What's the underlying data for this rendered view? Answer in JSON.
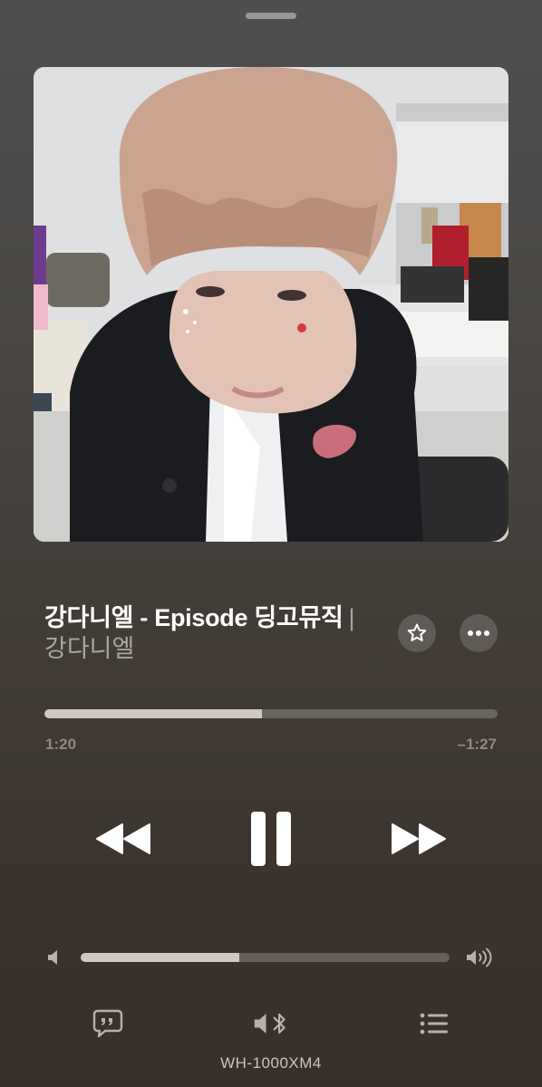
{
  "now_playing": {
    "title": "강다니엘 - Episode 딩고뮤직",
    "title_separator": "|",
    "artist": "강다니엘",
    "artwork_icon": "album-artwork-photo",
    "is_favorite": false
  },
  "progress": {
    "elapsed": "1:20",
    "remaining": "–1:27",
    "fraction": 0.48
  },
  "controls": {
    "rewind_icon": "rewind-icon",
    "playpause_icon": "pause-icon",
    "forward_icon": "fast-forward-icon",
    "star_icon": "star-icon",
    "more_icon": "ellipsis-icon"
  },
  "volume": {
    "level": 0.43,
    "low_icon": "speaker-low-icon",
    "high_icon": "speaker-high-icon"
  },
  "footer": {
    "lyrics_icon": "lyrics-bubble-icon",
    "output_icon": "bluetooth-speaker-icon",
    "queue_icon": "queue-list-icon",
    "device_name": "WH-1000XM4"
  },
  "colors": {
    "accent_fill": "#cfc9c4",
    "secondary_text": "#a9a5a1"
  }
}
